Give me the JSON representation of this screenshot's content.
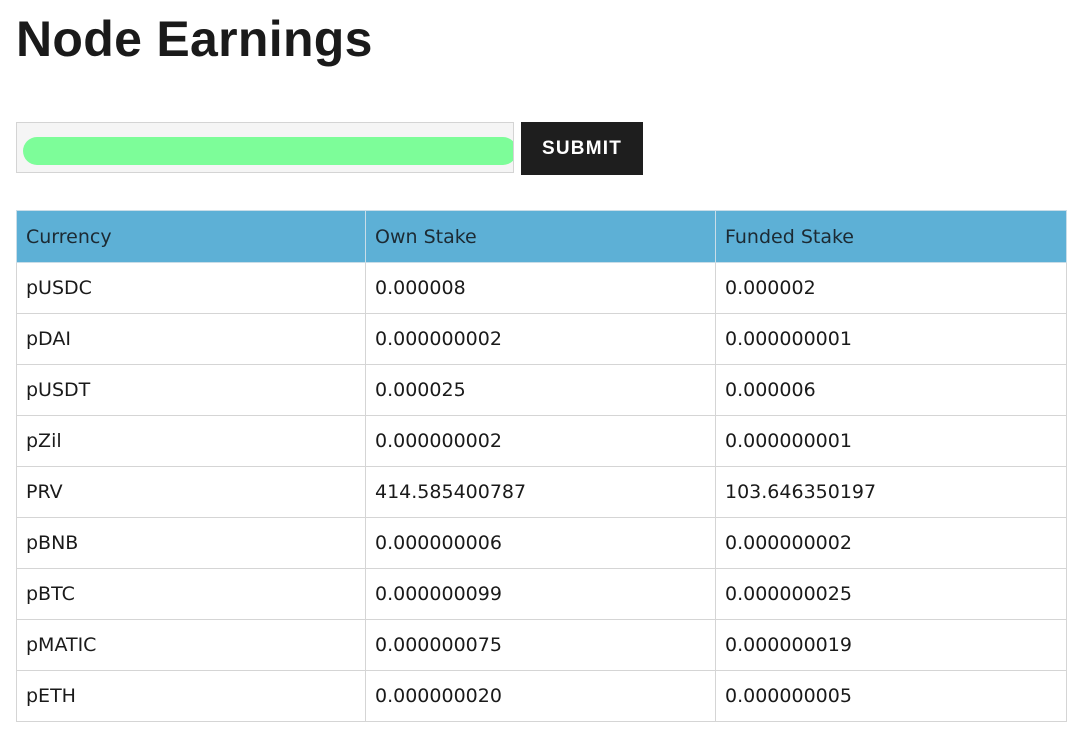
{
  "page": {
    "title": "Node Earnings"
  },
  "form": {
    "address_value": "",
    "submit_label": "SUBMIT",
    "redaction_color": "#7dfd99"
  },
  "table": {
    "header_color": "#5db0d6",
    "columns": [
      "Currency",
      "Own Stake",
      "Funded Stake"
    ],
    "rows": [
      {
        "currency": "pUSDC",
        "own_stake": "0.000008",
        "funded_stake": "0.000002"
      },
      {
        "currency": "pDAI",
        "own_stake": "0.000000002",
        "funded_stake": "0.000000001"
      },
      {
        "currency": "pUSDT",
        "own_stake": "0.000025",
        "funded_stake": "0.000006"
      },
      {
        "currency": "pZil",
        "own_stake": "0.000000002",
        "funded_stake": "0.000000001"
      },
      {
        "currency": "PRV",
        "own_stake": "414.585400787",
        "funded_stake": "103.646350197"
      },
      {
        "currency": "pBNB",
        "own_stake": "0.000000006",
        "funded_stake": "0.000000002"
      },
      {
        "currency": "pBTC",
        "own_stake": "0.000000099",
        "funded_stake": "0.000000025"
      },
      {
        "currency": "pMATIC",
        "own_stake": "0.000000075",
        "funded_stake": "0.000000019"
      },
      {
        "currency": "pETH",
        "own_stake": "0.000000020",
        "funded_stake": "0.000000005"
      }
    ]
  }
}
